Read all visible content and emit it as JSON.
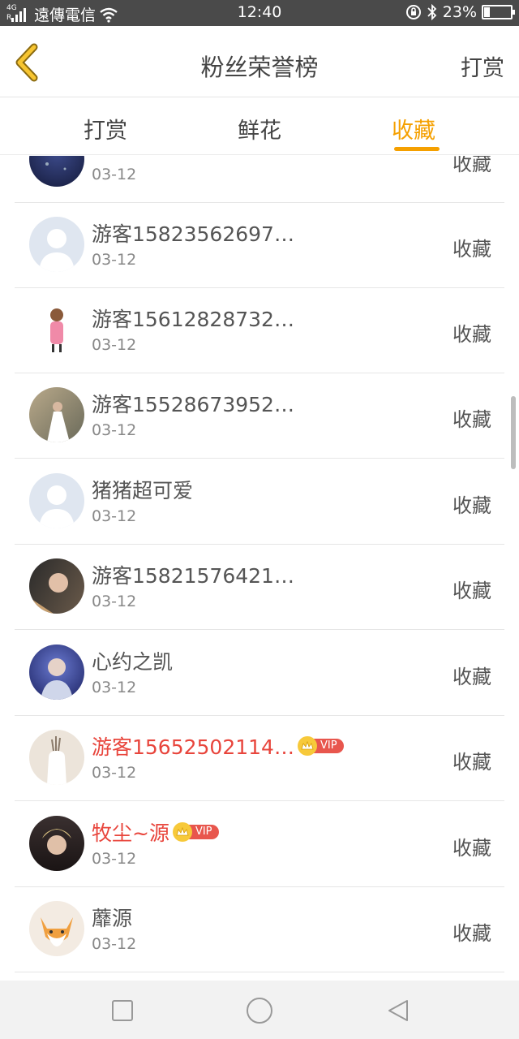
{
  "status_bar": {
    "network": "4G",
    "roaming": "R",
    "carrier": "遠傳電信",
    "time": "12:40",
    "battery": "23%",
    "battery_level": 0.23
  },
  "nav": {
    "title": "粉丝荣誉榜",
    "right_action": "打赏"
  },
  "tabs": [
    {
      "label": "打赏",
      "active": false
    },
    {
      "label": "鲜花",
      "active": false
    },
    {
      "label": "收藏",
      "active": true
    }
  ],
  "list": [
    {
      "name": "",
      "date": "03-12",
      "action": "收藏",
      "vip": false
    },
    {
      "name": "游客15823562697…",
      "date": "03-12",
      "action": "收藏",
      "vip": false
    },
    {
      "name": "游客15612828732…",
      "date": "03-12",
      "action": "收藏",
      "vip": false
    },
    {
      "name": "游客15528673952…",
      "date": "03-12",
      "action": "收藏",
      "vip": false
    },
    {
      "name": "猪猪超可爱",
      "date": "03-12",
      "action": "收藏",
      "vip": false
    },
    {
      "name": "游客15821576421…",
      "date": "03-12",
      "action": "收藏",
      "vip": false
    },
    {
      "name": "心约之凯",
      "date": "03-12",
      "action": "收藏",
      "vip": false
    },
    {
      "name": "游客15652502114…",
      "date": "03-12",
      "action": "收藏",
      "vip": true,
      "vip_label": "VIP"
    },
    {
      "name": "牧尘~源",
      "date": "03-12",
      "action": "收藏",
      "vip": true,
      "vip_label": "VIP"
    },
    {
      "name": "蘼源",
      "date": "03-12",
      "action": "收藏",
      "vip": false
    }
  ],
  "colors": {
    "accent": "#f5a000",
    "vip_name": "#e8453c",
    "status_bar_bg": "#4a4a4a"
  }
}
